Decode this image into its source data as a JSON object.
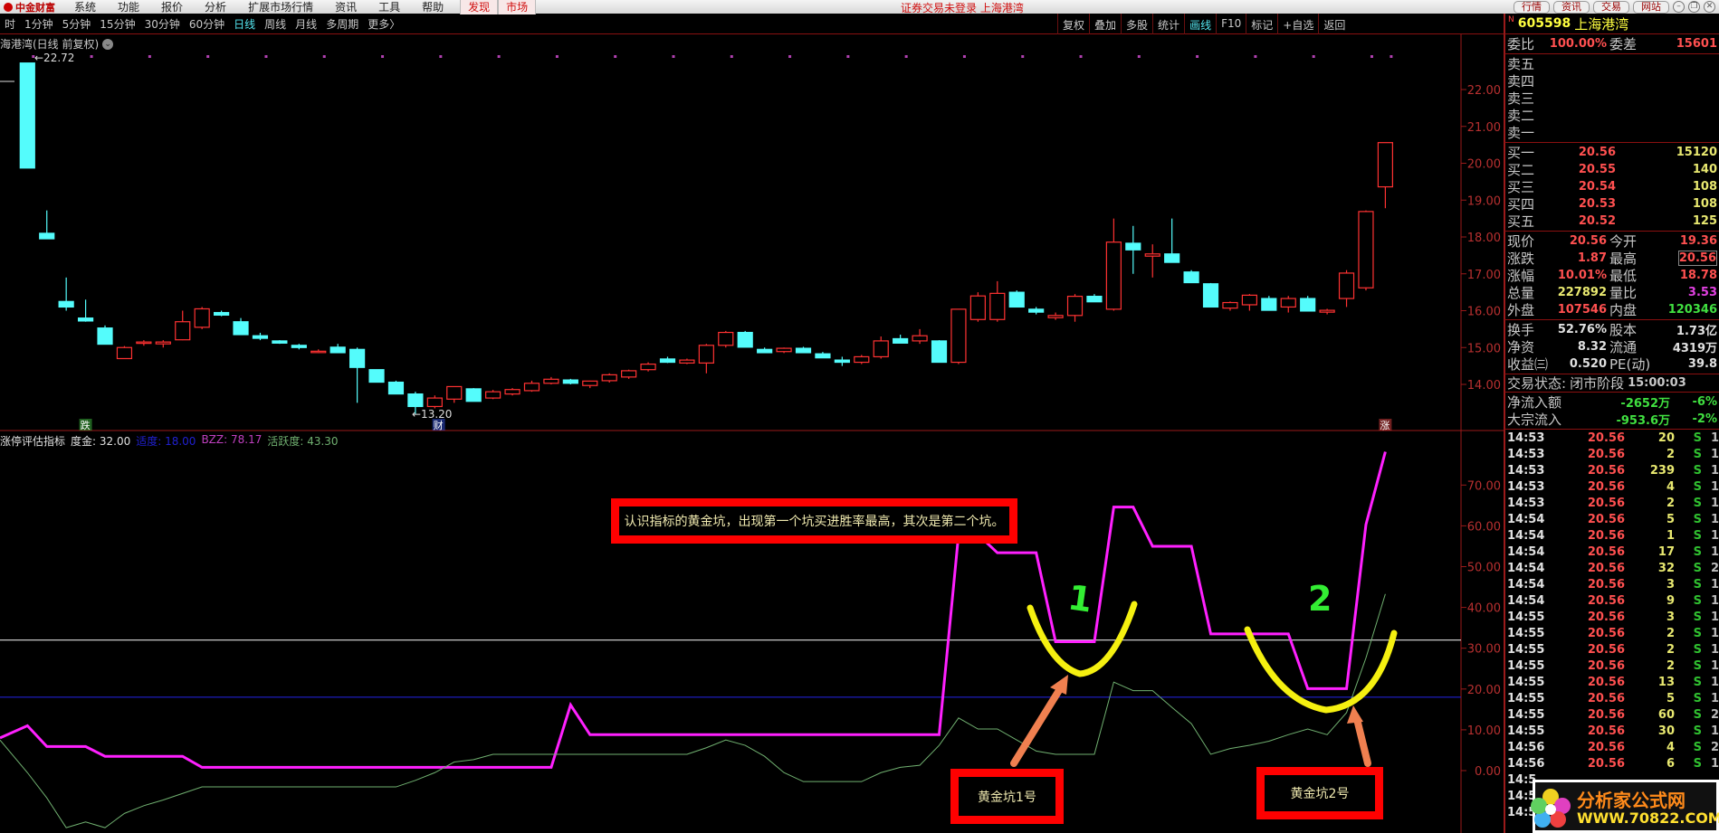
{
  "menubar": {
    "logo": "中金财富",
    "items": [
      "系统",
      "功能",
      "报价",
      "分析",
      "扩展市场行情",
      "资讯",
      "工具",
      "帮助"
    ],
    "red_items": [
      "发现",
      "市场"
    ],
    "title": "证券交易未登录 上海港湾",
    "right_buttons": [
      "行情",
      "资讯",
      "交易",
      "网站"
    ],
    "window_controls": [
      "–",
      "❐",
      "✕"
    ]
  },
  "period_tabs": [
    "时",
    "1分钟",
    "5分钟",
    "15分钟",
    "30分钟",
    "60分钟",
    "日线",
    "周线",
    "月线",
    "多周期",
    "更多〉"
  ],
  "period_active": "日线",
  "toolbar": [
    "复权",
    "叠加",
    "多股",
    "统计",
    "画线",
    "F10",
    "标记",
    "+自选",
    "返回"
  ],
  "toolbar_active": "画线",
  "chart": {
    "title": "海港湾(日线 前复权)",
    "high_label": "←22.72",
    "low_label": "←13.20",
    "markers": [
      "跌",
      "财",
      "涨"
    ],
    "price_ticks": [
      "22.00",
      "21.00",
      "20.00",
      "19.00",
      "18.00",
      "17.00",
      "16.00",
      "15.00",
      "14.00"
    ]
  },
  "indicator": {
    "name": "涨停评估指标",
    "items": [
      {
        "label": "度金: 32.00",
        "color": "#e0e0e0"
      },
      {
        "label": "适度: 18.00",
        "color": "#2020d0"
      },
      {
        "label": "BZZ: 78.17",
        "color": "#c040c0"
      },
      {
        "label": "活跃度: 43.30",
        "color": "#70b070"
      }
    ],
    "ticks": [
      "70.00",
      "60.00",
      "50.00",
      "40.00",
      "30.00",
      "20.00",
      "10.00",
      "0.00"
    ]
  },
  "annotations": {
    "main": "认识指标的黄金坑，出现第一个坑买进胜率最高，其次是第二个坑。",
    "pit1": "黄金坑1号",
    "pit2": "黄金坑2号",
    "hand1": "1",
    "hand2": "2"
  },
  "chart_data": [
    {
      "type": "candlestick",
      "ylim": [
        13,
        23
      ],
      "up_color": "#ff3232",
      "down_color": "#54fcfc",
      "ohlc": [
        [
          22.72,
          22.72,
          19.87,
          19.87
        ],
        [
          18.1,
          18.72,
          17.95,
          17.95
        ],
        [
          16.25,
          16.9,
          16.0,
          16.1
        ],
        [
          15.8,
          16.3,
          15.7,
          15.72
        ],
        [
          15.53,
          15.6,
          15.09,
          15.09
        ],
        [
          14.7,
          15.04,
          14.69,
          15.0
        ],
        [
          15.12,
          15.2,
          15.05,
          15.15
        ],
        [
          15.1,
          15.2,
          15.0,
          15.15
        ],
        [
          15.21,
          16.0,
          15.2,
          15.7
        ],
        [
          15.55,
          16.1,
          15.5,
          16.05
        ],
        [
          15.95,
          16.0,
          15.85,
          15.88
        ],
        [
          15.7,
          15.8,
          15.35,
          15.35
        ],
        [
          15.32,
          15.4,
          15.2,
          15.25
        ],
        [
          15.18,
          15.2,
          15.1,
          15.12
        ],
        [
          15.06,
          15.1,
          14.95,
          15.0
        ],
        [
          14.88,
          14.95,
          14.85,
          14.9
        ],
        [
          15.01,
          15.1,
          14.86,
          14.86
        ],
        [
          14.95,
          15.0,
          13.5,
          14.46
        ],
        [
          14.4,
          14.4,
          14.05,
          14.06
        ],
        [
          14.06,
          14.1,
          13.74,
          13.74
        ],
        [
          13.74,
          13.8,
          13.2,
          13.4
        ],
        [
          13.4,
          13.7,
          13.35,
          13.63
        ],
        [
          13.6,
          13.95,
          13.5,
          13.94
        ],
        [
          13.88,
          13.9,
          13.54,
          13.54
        ],
        [
          13.63,
          13.85,
          13.6,
          13.8
        ],
        [
          13.74,
          13.9,
          13.7,
          13.86
        ],
        [
          13.83,
          14.1,
          13.8,
          14.03
        ],
        [
          14.03,
          14.2,
          14.0,
          14.14
        ],
        [
          14.12,
          14.15,
          14.0,
          14.03
        ],
        [
          13.97,
          14.1,
          13.9,
          14.09
        ],
        [
          14.1,
          14.3,
          14.05,
          14.26
        ],
        [
          14.2,
          14.4,
          14.15,
          14.37
        ],
        [
          14.4,
          14.6,
          14.35,
          14.55
        ],
        [
          14.69,
          14.75,
          14.58,
          14.6
        ],
        [
          14.58,
          14.7,
          14.55,
          14.66
        ],
        [
          14.58,
          15.1,
          14.3,
          15.06
        ],
        [
          15.06,
          15.45,
          15.0,
          15.41
        ],
        [
          15.41,
          15.45,
          15.01,
          15.01
        ],
        [
          14.95,
          15.0,
          14.86,
          14.86
        ],
        [
          14.89,
          15.0,
          14.85,
          14.98
        ],
        [
          14.98,
          15.02,
          14.86,
          14.86
        ],
        [
          14.83,
          14.88,
          14.72,
          14.72
        ],
        [
          14.66,
          14.75,
          14.5,
          14.6
        ],
        [
          14.6,
          14.8,
          14.55,
          14.75
        ],
        [
          14.75,
          15.3,
          14.7,
          15.18
        ],
        [
          15.24,
          15.35,
          15.12,
          15.12
        ],
        [
          15.18,
          15.5,
          15.1,
          15.32
        ],
        [
          15.18,
          15.2,
          14.6,
          14.6
        ],
        [
          14.6,
          16.0,
          14.55,
          16.04
        ],
        [
          15.76,
          16.5,
          15.7,
          16.4
        ],
        [
          15.76,
          16.8,
          15.7,
          16.47
        ],
        [
          16.5,
          16.55,
          16.1,
          16.1
        ],
        [
          16.04,
          16.1,
          15.9,
          15.96
        ],
        [
          15.81,
          15.95,
          15.75,
          15.87
        ],
        [
          15.87,
          16.45,
          15.7,
          16.39
        ],
        [
          16.39,
          16.45,
          16.24,
          16.24
        ],
        [
          16.04,
          18.5,
          16.0,
          17.86
        ],
        [
          17.83,
          18.3,
          17.0,
          17.65
        ],
        [
          17.48,
          17.8,
          16.9,
          17.54
        ],
        [
          17.54,
          18.5,
          17.31,
          17.31
        ],
        [
          17.05,
          17.1,
          16.76,
          16.76
        ],
        [
          16.73,
          16.75,
          16.1,
          16.1
        ],
        [
          16.07,
          16.25,
          16.0,
          16.22
        ],
        [
          16.16,
          16.45,
          16.0,
          16.42
        ],
        [
          16.33,
          16.4,
          16.01,
          16.01
        ],
        [
          16.1,
          16.4,
          15.95,
          16.33
        ],
        [
          16.33,
          16.4,
          15.99,
          15.99
        ],
        [
          15.96,
          16.05,
          15.9,
          16.01
        ],
        [
          16.33,
          17.1,
          16.1,
          17.02
        ],
        [
          16.62,
          18.72,
          16.55,
          18.69
        ],
        [
          19.36,
          20.56,
          18.78,
          20.56
        ]
      ]
    },
    {
      "type": "line",
      "ylim": [
        -15,
        80
      ],
      "hlines": [
        {
          "name": "度金",
          "value": 32.0,
          "color": "#e0e0e0"
        },
        {
          "name": "适度",
          "value": 18.0,
          "color": "#2020d0"
        }
      ],
      "series": [
        {
          "name": "BZZ",
          "color": "#ff20ff",
          "values": [
            11,
            5.9,
            5.9,
            5.9,
            3.5,
            3.5,
            3.5,
            3.5,
            3.5,
            0.8,
            0.8,
            0.8,
            0.8,
            0.8,
            0.8,
            0.8,
            0.8,
            0.8,
            0.8,
            0.8,
            0.8,
            0.8,
            0.8,
            0.8,
            0.8,
            0.8,
            0.8,
            0.8,
            16.1,
            8.8,
            8.8,
            8.8,
            8.8,
            8.8,
            8.8,
            8.8,
            8.8,
            8.8,
            8.8,
            8.8,
            8.8,
            8.8,
            8.8,
            8.8,
            8.8,
            8.8,
            8.8,
            8.8,
            57.9,
            57.9,
            53.4,
            53.4,
            53.4,
            31.6,
            31.6,
            31.6,
            64.6,
            64.6,
            55,
            55,
            55,
            33.5,
            33.5,
            33.5,
            33.5,
            33.5,
            20.1,
            20.1,
            20.1,
            60.3,
            78.17
          ]
        },
        {
          "name": "活跃度",
          "color": "#70b070",
          "values": [
            -0.5,
            -6.7,
            -14,
            -12.6,
            -14,
            -10.5,
            -8.6,
            -7.2,
            -5.6,
            -4,
            -4,
            -4,
            -4,
            -4,
            -4,
            -4,
            -4,
            -4,
            -4,
            -4,
            -2.4,
            -0.5,
            2.1,
            2.7,
            4,
            4,
            4,
            4,
            4,
            4,
            4,
            4,
            4,
            4,
            4,
            5.6,
            7.5,
            6.2,
            3.5,
            -0.5,
            -2.7,
            -2.7,
            -2.7,
            -2.7,
            -0.5,
            0.8,
            1.3,
            6.2,
            12.9,
            10.2,
            10.2,
            7.5,
            4.8,
            4,
            4,
            4,
            21.7,
            19.6,
            19.6,
            15.5,
            11.5,
            4,
            5.4,
            6.2,
            7.2,
            8.8,
            10.2,
            8.8,
            14.2,
            27.6,
            43.3
          ]
        }
      ]
    }
  ],
  "quote": {
    "code": "605598",
    "name": "上海港湾",
    "badge": "N",
    "weibi": {
      "l": "委比",
      "v": "100.00%",
      "l2": "委差",
      "v2": "15601"
    },
    "sells": [
      "卖五",
      "卖四",
      "卖三",
      "卖二",
      "卖一"
    ],
    "buys": [
      {
        "l": "买一",
        "p": "20.56",
        "q": "15120"
      },
      {
        "l": "买二",
        "p": "20.55",
        "q": "140"
      },
      {
        "l": "买三",
        "p": "20.54",
        "q": "108"
      },
      {
        "l": "买四",
        "p": "20.53",
        "q": "108"
      },
      {
        "l": "买五",
        "p": "20.52",
        "q": "125"
      }
    ],
    "stats1": [
      {
        "l": "现价",
        "v": "20.56",
        "c": "red",
        "l2": "今开",
        "v2": "19.36",
        "c2": "red"
      },
      {
        "l": "涨跌",
        "v": "1.87",
        "c": "red",
        "l2": "最高",
        "v2": "20.56",
        "c2": "red"
      },
      {
        "l": "涨幅",
        "v": "10.01%",
        "c": "red",
        "l2": "最低",
        "v2": "18.78",
        "c2": "red"
      },
      {
        "l": "总量",
        "v": "227892",
        "c": "yel",
        "l2": "量比",
        "v2": "3.53",
        "c2": "mag"
      },
      {
        "l": "外盘",
        "v": "107546",
        "c": "red",
        "l2": "内盘",
        "v2": "120346",
        "c2": "grn"
      }
    ],
    "stats2": [
      {
        "l": "换手",
        "v": "52.76%",
        "c": "wht",
        "l2": "股本",
        "v2": "1.73亿",
        "c2": "wht"
      },
      {
        "l": "净资",
        "v": "8.32",
        "c": "wht",
        "l2": "流通",
        "v2": "4319万",
        "c2": "wht"
      },
      {
        "l": "收益㈢",
        "v": "0.520",
        "c": "wht",
        "l2": "PE(动)",
        "v2": "39.8",
        "c2": "wht"
      }
    ],
    "status": {
      "label": "交易状态:",
      "phase": "闭市阶段",
      "time": "15:00:03"
    },
    "flows": [
      {
        "l": "净流入额",
        "v": "-2652万",
        "pct": "-6%"
      },
      {
        "l": "大宗流入",
        "v": "-953.6万",
        "pct": "-2%"
      }
    ],
    "ticks": [
      [
        "14:53",
        "20.56",
        "20",
        "S",
        "1"
      ],
      [
        "14:53",
        "20.56",
        "2",
        "S",
        "1"
      ],
      [
        "14:53",
        "20.56",
        "239",
        "S",
        "1"
      ],
      [
        "14:53",
        "20.56",
        "4",
        "S",
        "1"
      ],
      [
        "14:53",
        "20.56",
        "2",
        "S",
        "1"
      ],
      [
        "14:54",
        "20.56",
        "5",
        "S",
        "1"
      ],
      [
        "14:54",
        "20.56",
        "1",
        "S",
        "1"
      ],
      [
        "14:54",
        "20.56",
        "17",
        "S",
        "1"
      ],
      [
        "14:54",
        "20.56",
        "32",
        "S",
        "2"
      ],
      [
        "14:54",
        "20.56",
        "3",
        "S",
        "1"
      ],
      [
        "14:54",
        "20.56",
        "9",
        "S",
        "1"
      ],
      [
        "14:55",
        "20.56",
        "3",
        "S",
        "1"
      ],
      [
        "14:55",
        "20.56",
        "2",
        "S",
        "1"
      ],
      [
        "14:55",
        "20.56",
        "2",
        "S",
        "1"
      ],
      [
        "14:55",
        "20.56",
        "2",
        "S",
        "1"
      ],
      [
        "14:55",
        "20.56",
        "13",
        "S",
        "1"
      ],
      [
        "14:55",
        "20.56",
        "5",
        "S",
        "1"
      ],
      [
        "14:55",
        "20.56",
        "60",
        "S",
        "2"
      ],
      [
        "14:55",
        "20.56",
        "30",
        "S",
        "1"
      ],
      [
        "14:56",
        "20.56",
        "4",
        "S",
        "2"
      ],
      [
        "14:56",
        "20.56",
        "6",
        "S",
        "1"
      ],
      [
        "14:5",
        "",
        "",
        "",
        ""
      ],
      [
        "14:5",
        "",
        "",
        "",
        ""
      ],
      [
        "14:5",
        "",
        "",
        "",
        ""
      ]
    ]
  },
  "watermark": {
    "title": "分析家公式网",
    "url": "WWW.70822.COM"
  }
}
